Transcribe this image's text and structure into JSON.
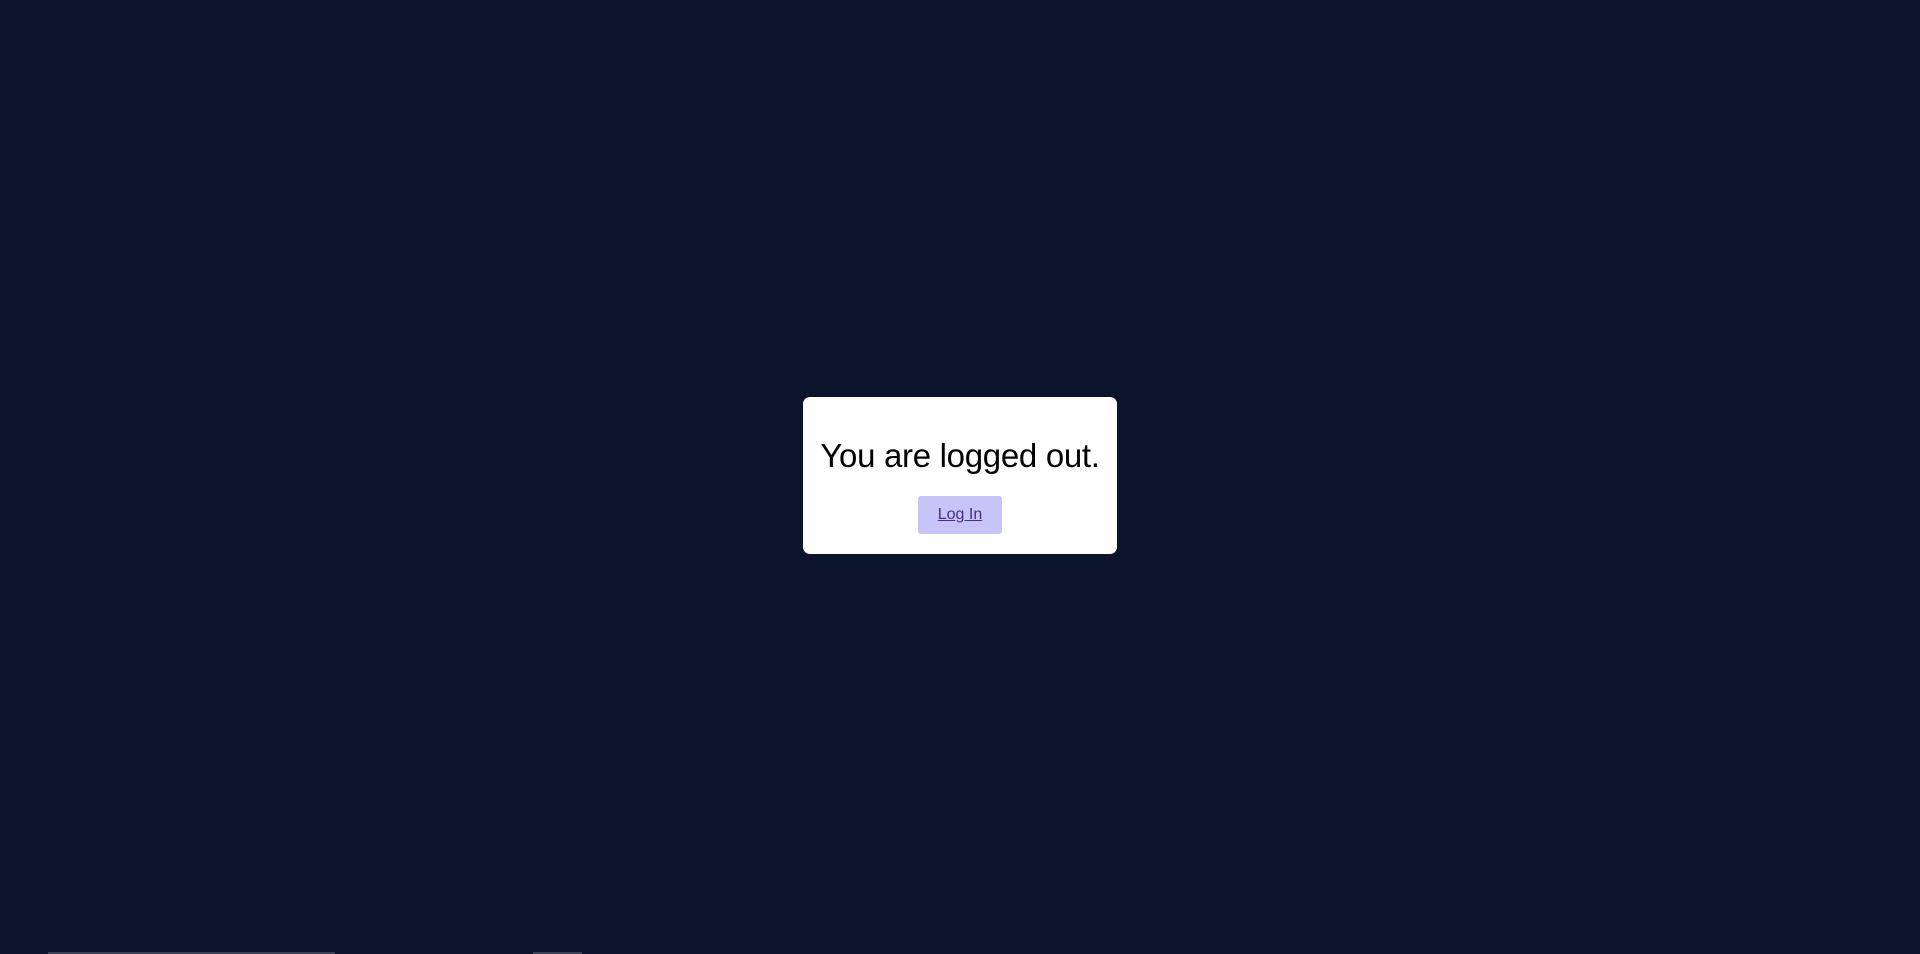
{
  "dialog": {
    "title": "You are logged out.",
    "login_label": "Log In"
  },
  "colors": {
    "page_background": "#0c132c",
    "card_background": "#ffffff",
    "button_background": "#c7c4f7",
    "button_text": "#4a2e88"
  }
}
